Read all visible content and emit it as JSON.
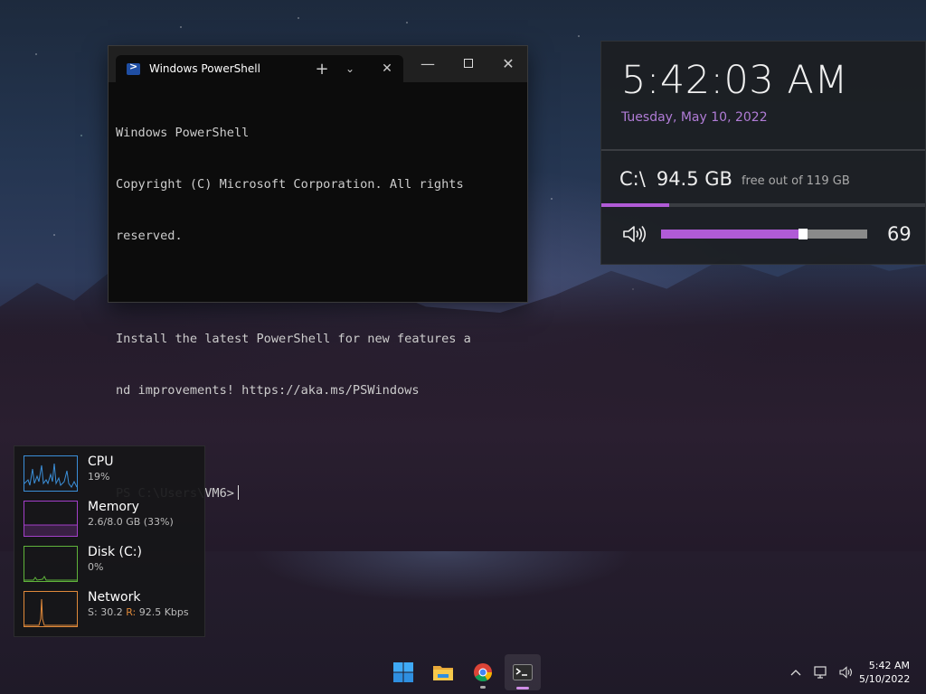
{
  "terminal": {
    "tab_title": "Windows PowerShell",
    "tab_close": "✕",
    "new_tab": "+",
    "dropdown": "⌄",
    "minimize": "—",
    "close": "✕",
    "lines": [
      "Windows PowerShell",
      "Copyright (C) Microsoft Corporation. All rights",
      "reserved.",
      "",
      "Install the latest PowerShell for new features a",
      "nd improvements! https://aka.ms/PSWindows",
      "",
      "PS C:\\Users\\VM6>"
    ]
  },
  "clock_widget": {
    "time": "5:42:03 AM",
    "date": "Tuesday, May 10, 2022",
    "disk_label": "C:\\",
    "disk_free": "94.5 GB",
    "disk_sub": "free out of 119 GB",
    "disk_used_fraction": 0.21,
    "volume": "69",
    "volume_fraction": 0.69,
    "accent_color": "#b05bd6",
    "date_color": "#b07cd6",
    "volume_icon": "speaker-icon"
  },
  "perf": {
    "cpu": {
      "name": "CPU",
      "value": "19%",
      "color": "#3b8fd9"
    },
    "memory": {
      "name": "Memory",
      "value": "2.6/8.0 GB (33%)",
      "color": "#a33fc9"
    },
    "disk": {
      "name": "Disk (C:)",
      "value": "0%",
      "color": "#5fb33a"
    },
    "network": {
      "name": "Network",
      "send_label": "S:",
      "send": "30.2",
      "recv_label": "R:",
      "recv": "92.5 Kbps",
      "color": "#e0893a"
    }
  },
  "taskbar": {
    "apps": [
      "windows-start-icon",
      "file-explorer-icon",
      "chrome-icon",
      "terminal-icon"
    ],
    "tray_icons": [
      "chevron-up-icon",
      "network-icon",
      "speaker-icon"
    ],
    "time": "5:42 AM",
    "date": "5/10/2022"
  }
}
